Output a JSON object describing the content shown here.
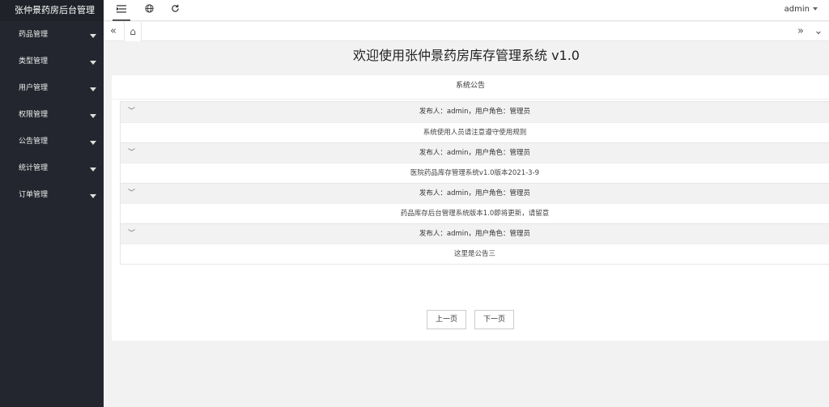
{
  "app": {
    "title": "张仲景药房后台管理"
  },
  "sidebar": {
    "items": [
      {
        "label": "药品管理"
      },
      {
        "label": "类型管理"
      },
      {
        "label": "用户管理"
      },
      {
        "label": "权限管理"
      },
      {
        "label": "公告管理"
      },
      {
        "label": "统计管理"
      },
      {
        "label": "订单管理"
      }
    ]
  },
  "header": {
    "icons": [
      "menu-toggle-icon",
      "globe-icon",
      "refresh-icon"
    ],
    "user": "admin"
  },
  "tabbar": {
    "prev_icon": "«",
    "next_icon": "»",
    "home_icon": "⌂",
    "dropdown_icon": "⌄"
  },
  "main": {
    "title": "欢迎使用张仲景药房库存管理系统 v1.0",
    "notice_title": "系统公告",
    "notices": [
      {
        "header": "发布人：admin，用户角色：管理员",
        "content": "系统使用人员请注意遵守使用规则"
      },
      {
        "header": "发布人：admin，用户角色：管理员",
        "content": "医院药品库存管理系统v1.0版本2021-3-9"
      },
      {
        "header": "发布人：admin，用户角色：管理员",
        "content": "药品库存后台管理系统版本1.0即将更新，请留意"
      },
      {
        "header": "发布人：admin，用户角色：管理员",
        "content": "这里是公告三"
      }
    ],
    "pager": {
      "prev": "上一页",
      "next": "下一页"
    }
  }
}
